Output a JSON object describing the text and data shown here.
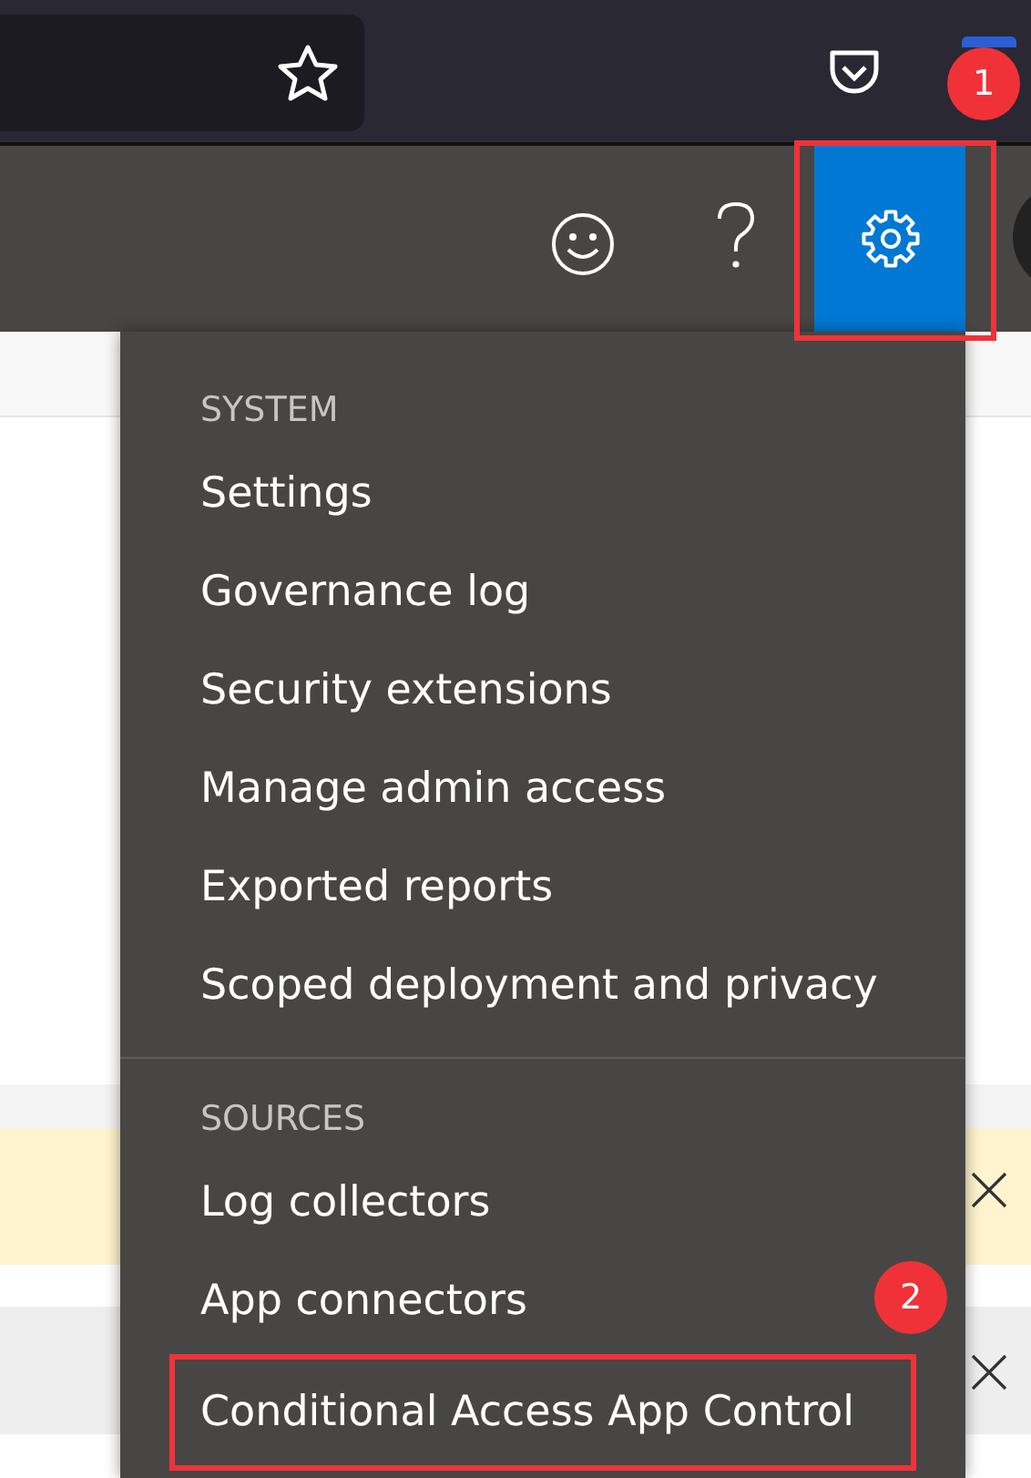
{
  "header": {
    "settings_open": true
  },
  "menu": {
    "sections": [
      {
        "title": "SYSTEM",
        "items": [
          {
            "label": "Settings",
            "marked": false
          },
          {
            "label": "Governance log",
            "marked": false
          },
          {
            "label": "Security extensions",
            "marked": false
          },
          {
            "label": "Manage admin access",
            "marked": false
          },
          {
            "label": "Exported reports",
            "marked": false
          },
          {
            "label": "Scoped deployment and privacy",
            "marked": false
          }
        ]
      },
      {
        "title": "SOURCES",
        "items": [
          {
            "label": "Log collectors",
            "marked": false
          },
          {
            "label": "App connectors",
            "marked": false
          },
          {
            "label": "Conditional Access App Control",
            "marked": true
          }
        ]
      }
    ]
  },
  "annotations": [
    {
      "label": "1"
    },
    {
      "label": "2"
    }
  ]
}
